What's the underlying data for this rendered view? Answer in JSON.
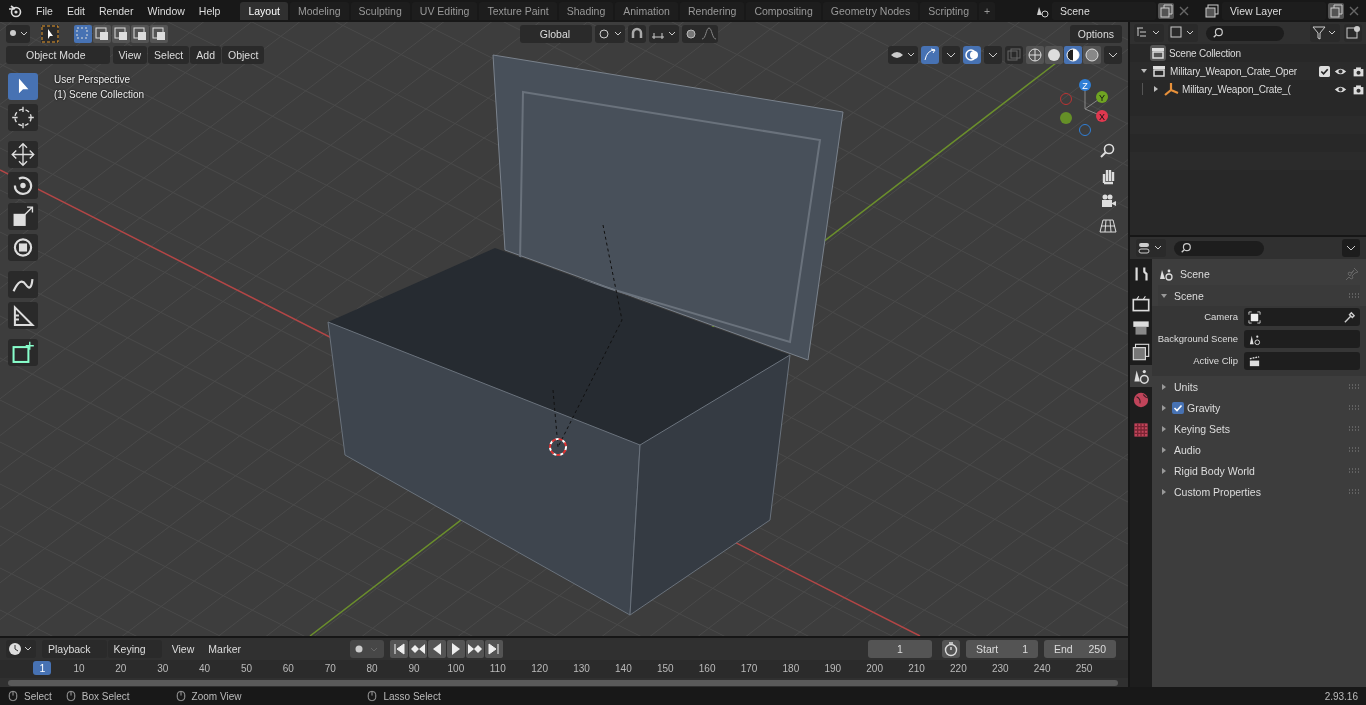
{
  "menu_bar": {
    "menus": [
      "File",
      "Edit",
      "Render",
      "Window",
      "Help"
    ]
  },
  "workspaces": [
    {
      "label": "Layout",
      "selected": true
    },
    {
      "label": "Modeling",
      "selected": false
    },
    {
      "label": "Sculpting",
      "selected": false
    },
    {
      "label": "UV Editing",
      "selected": false
    },
    {
      "label": "Texture Paint",
      "selected": false
    },
    {
      "label": "Shading",
      "selected": false
    },
    {
      "label": "Animation",
      "selected": false
    },
    {
      "label": "Rendering",
      "selected": false
    },
    {
      "label": "Compositing",
      "selected": false
    },
    {
      "label": "Geometry Nodes",
      "selected": false
    },
    {
      "label": "Scripting",
      "selected": false
    }
  ],
  "add_workspace": "+",
  "scene_selector": {
    "value": "Scene"
  },
  "view_layer_selector": {
    "value": "View Layer"
  },
  "tool_header": {
    "select_modes": [
      {
        "selected": true
      },
      {
        "selected": false
      },
      {
        "selected": false
      },
      {
        "selected": false
      },
      {
        "selected": false
      }
    ],
    "transform_orientation": "Global",
    "options": "Options"
  },
  "viewport_header": {
    "mode": "Object Mode",
    "menus": [
      "View",
      "Select",
      "Add",
      "Object"
    ],
    "shading_modes": [
      {
        "selected": false
      },
      {
        "selected": false
      },
      {
        "selected": true
      },
      {
        "selected": false
      }
    ]
  },
  "viewport": {
    "overlay_lines": [
      "User Perspective",
      "(1) Scene Collection"
    ],
    "tools": [
      {
        "kind": "select",
        "selected": true
      },
      {
        "kind": "cursor",
        "selected": false
      },
      {
        "kind": "move",
        "selected": false
      },
      {
        "kind": "rotate",
        "selected": false
      },
      {
        "kind": "scale",
        "selected": false
      },
      {
        "kind": "transform",
        "selected": false
      },
      {
        "kind": "annotate",
        "selected": false
      },
      {
        "kind": "measure",
        "selected": false
      },
      {
        "kind": "add-cube",
        "selected": false
      }
    ],
    "gizmo_axes": [
      "Z",
      "Y",
      "X"
    ]
  },
  "outliner": {
    "items": [
      {
        "label": "Scene Collection",
        "kind": "scene",
        "children": [
          {
            "label": "Military_Weapon_Crate_Oper",
            "kind": "collection",
            "expanded": true,
            "checked": true,
            "children": [
              {
                "label": "Military_Weapon_Crate_(",
                "kind": "object",
                "expanded": false
              }
            ]
          }
        ]
      }
    ]
  },
  "properties": {
    "tabs": [
      {
        "kind": "tool",
        "selected": false
      },
      {
        "kind": "render",
        "selected": false
      },
      {
        "kind": "output",
        "selected": false
      },
      {
        "kind": "view-layer",
        "selected": false
      },
      {
        "kind": "scene",
        "selected": true
      },
      {
        "kind": "world",
        "selected": false
      },
      {
        "kind": "texture",
        "selected": false
      }
    ],
    "context_title": "Scene",
    "panel": {
      "title": "Scene",
      "expanded": true,
      "fields": [
        {
          "label": "Camera",
          "kind": "camera"
        },
        {
          "label": "Background Scene",
          "kind": "scene"
        },
        {
          "label": "Active Clip",
          "kind": "clip"
        }
      ]
    },
    "sections": [
      {
        "title": "Units",
        "expanded": false
      },
      {
        "title": "Gravity",
        "expanded": false,
        "checked": true
      },
      {
        "title": "Keying Sets",
        "expanded": false
      },
      {
        "title": "Audio",
        "expanded": false
      },
      {
        "title": "Rigid Body World",
        "expanded": false
      },
      {
        "title": "Custom Properties",
        "expanded": false
      }
    ]
  },
  "timeline": {
    "dropdowns": [
      "Playback",
      "Keying"
    ],
    "menus": [
      "View",
      "Marker"
    ],
    "current_frame": "1",
    "start_label": "Start",
    "start": "1",
    "end_label": "End",
    "end": "250",
    "playhead": "1",
    "ruler": [
      "10",
      "20",
      "30",
      "40",
      "50",
      "60",
      "70",
      "80",
      "90",
      "100",
      "110",
      "120",
      "130",
      "140",
      "150",
      "160",
      "170",
      "180",
      "190",
      "200",
      "210",
      "220",
      "230",
      "240",
      "250"
    ]
  },
  "status_bar": {
    "hints": [
      "Select",
      "Box Select",
      "Zoom View",
      "Lasso Select"
    ],
    "version": "2.93.16"
  }
}
